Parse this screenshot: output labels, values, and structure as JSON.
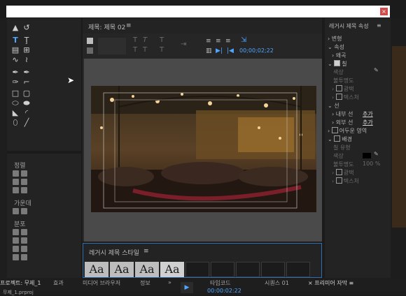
{
  "window": {
    "close_icon": "×"
  },
  "left_panel": {
    "groups": [
      "정렬",
      "가운데",
      "분포"
    ]
  },
  "program": {
    "title": "제목: 제목 02",
    "menu": "≡",
    "timecode": "00;00;02;22"
  },
  "styles_panel": {
    "title": "레거시 제목 스타일",
    "menu": "≡",
    "samples": [
      "Aa",
      "Aa",
      "Aa",
      "Aa"
    ]
  },
  "properties": {
    "title": "레거시 제목 속성",
    "menu": "≡",
    "transform": "변형",
    "props": "속성",
    "distort": "왜곡",
    "fill": "칠",
    "fill_color": "색상",
    "fill_opacity": "불투명도",
    "fill_sheen": "광택",
    "fill_texture": "텍스처",
    "stroke": "선",
    "inner_stroke": "내부 선",
    "outer_stroke": "외부 선",
    "add1": "추가",
    "add2": "추가",
    "shadow": "어두운 영역",
    "background": "배경",
    "bg_fill_type": "칠 유형",
    "bg_color": "색상",
    "bg_opacity": "불투명도",
    "bg_opacity_value": "100 %",
    "bg_sheen": "광택",
    "bg_texture": "텍스처"
  },
  "bottom_tabs": [
    {
      "label": "프로젝트: 무제_1"
    },
    {
      "label": "효과"
    },
    {
      "label": "미디어 브라우저"
    },
    {
      "label": "정보"
    },
    {
      "label": "»"
    },
    {
      "label": "타임코드"
    },
    {
      "label": "시퀀스 01"
    },
    {
      "label": "프리미어 자막"
    }
  ],
  "bottom_timecode": "00:00:02:22",
  "bottom_project": "무제_1.prproj"
}
